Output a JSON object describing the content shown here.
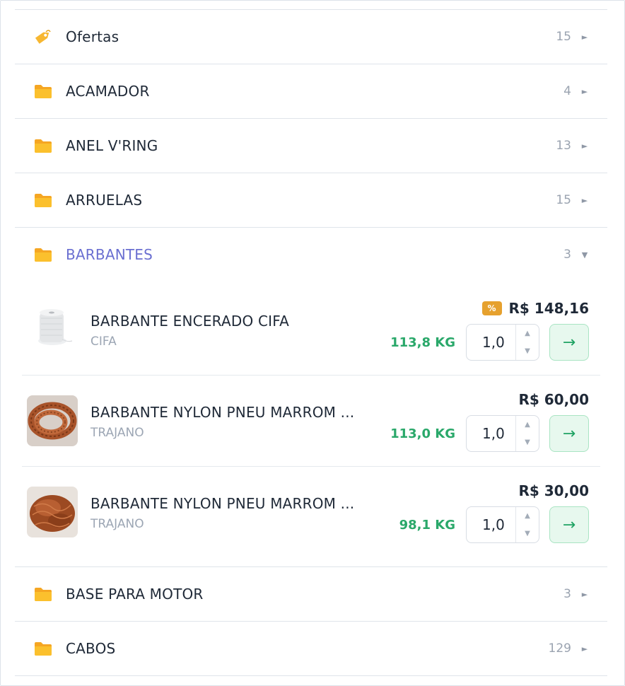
{
  "categories_before": [
    {
      "name": "Ofertas",
      "count": "15",
      "icon": "tag-icon",
      "chevron": "►"
    },
    {
      "name": "ACAMADOR",
      "count": "4",
      "icon": "folder-icon",
      "chevron": "►"
    },
    {
      "name": "ANEL V'RING",
      "count": "13",
      "icon": "folder-icon",
      "chevron": "►"
    },
    {
      "name": "ARRUELAS",
      "count": "15",
      "icon": "folder-icon",
      "chevron": "►"
    }
  ],
  "active_category": {
    "name": "BARBANTES",
    "count": "3",
    "icon": "folder-icon",
    "chevron": "▼"
  },
  "products": [
    {
      "name": "BARBANTE ENCERADO CIFA",
      "brand": "CIFA",
      "price": "R$ 148,16",
      "badge": "%",
      "stock": "113,8 KG",
      "qty": "1,0",
      "go": "→",
      "thumb": "white-twine-spool"
    },
    {
      "name": "BARBANTE NYLON PNEU MARROM ...",
      "brand": "TRAJANO",
      "price": "R$ 60,00",
      "badge": "",
      "stock": "113,0 KG",
      "qty": "1,0",
      "go": "→",
      "thumb": "brown-twine-coil"
    },
    {
      "name": "BARBANTE NYLON PNEU MARROM ...",
      "brand": "TRAJANO",
      "price": "R$ 30,00",
      "badge": "",
      "stock": "98,1 KG",
      "qty": "1,0",
      "go": "→",
      "thumb": "brown-twine-pile"
    }
  ],
  "stepper": {
    "up": "▲",
    "down": "▼"
  },
  "categories_after": [
    {
      "name": "BASE PARA MOTOR",
      "count": "3",
      "icon": "folder-icon",
      "chevron": "►"
    },
    {
      "name": "CABOS",
      "count": "129",
      "icon": "folder-icon",
      "chevron": "►"
    }
  ],
  "colors": {
    "accent": "#6a6fd1",
    "stock": "#2aa86a",
    "badge": "#e6a12e",
    "folder": "#f7b731"
  }
}
